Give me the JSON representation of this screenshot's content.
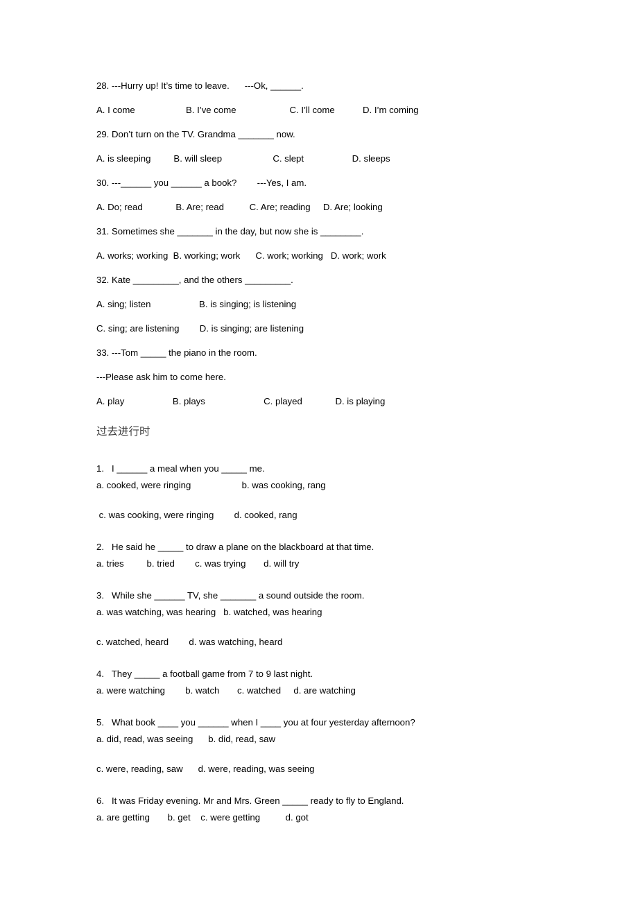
{
  "document": {
    "background_color": "#ffffff",
    "text_color": "#000000",
    "heading_color": "#3f3f3f"
  },
  "section_present_continuous": {
    "questions": [
      {
        "stem": "28. ---Hurry up! It’s time to leave.      ---Ok, ______.",
        "option_lines": [
          "A. I come                    B. I’ve come                     C. I’ll come           D. I’m coming"
        ]
      },
      {
        "stem": "29. Don’t turn on the TV. Grandma _______ now.",
        "option_lines": [
          "A. is sleeping         B. will sleep                    C. slept                   D. sleeps"
        ]
      },
      {
        "stem": "30. ---______ you ______ a book?        ---Yes, I am.",
        "option_lines": [
          "A. Do; read             B. Are; read          C. Are; reading     D. Are; looking"
        ]
      },
      {
        "stem": "31. Sometimes she _______ in the day, but now she is ________.",
        "option_lines": [
          "A. works; working  B. working; work      C. work; working   D. work; work"
        ]
      },
      {
        "stem": "32. Kate _________, and the others _________.",
        "option_lines": [
          "A. sing; listen                   B. is singing; is listening",
          "C. sing; are listening        D. is singing; are listening"
        ]
      },
      {
        "stem": "33. ---Tom _____ the piano in the room.",
        "continuation": "---Please ask him to come here.",
        "option_lines": [
          "A. play                   B. plays                       C. played             D. is playing"
        ]
      }
    ]
  },
  "section_past_continuous": {
    "heading": "过去进行时",
    "items": [
      {
        "stem": "1.   I ______ a meal when you _____ me.",
        "option_lines": [
          "a. cooked, were ringing                    b. was cooking, rang",
          " c. was cooking, were ringing        d. cooked, rang"
        ],
        "spaced_after": 1
      },
      {
        "stem": "2.   He said he _____ to draw a plane on the blackboard at that time.",
        "option_lines": [
          "a. tries         b. tried        c. was trying       d. will try"
        ]
      },
      {
        "stem": "3.   While she ______ TV, she _______ a sound outside the room.",
        "option_lines": [
          "a. was watching, was hearing   b. watched, was hearing",
          "c. watched, heard        d. was watching, heard"
        ],
        "spaced_after": 1
      },
      {
        "stem": "4.   They _____ a football game from 7 to 9 last night.",
        "option_lines": [
          "a. were watching        b. watch       c. watched     d. are watching"
        ]
      },
      {
        "stem": "5.   What book ____ you ______ when I ____ you at four yesterday afternoon?",
        "option_lines": [
          "a. did, read, was seeing      b. did, read, saw",
          "c. were, reading, saw      d. were, reading, was seeing"
        ],
        "spaced_after": 1
      },
      {
        "stem": "6.   It was Friday evening. Mr and Mrs. Green _____ ready to fly to England.",
        "option_lines": [
          "a. are getting       b. get    c. were getting          d. got"
        ]
      }
    ]
  }
}
